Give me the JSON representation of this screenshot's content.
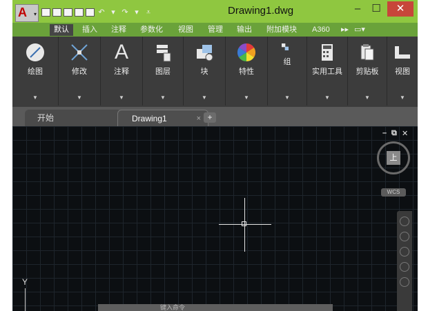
{
  "window": {
    "title": "Drawing1.dwg"
  },
  "app_menu": {
    "logo_letter": "A"
  },
  "ribbon_tabs": [
    {
      "label": "默认"
    },
    {
      "label": "插入"
    },
    {
      "label": "注释"
    },
    {
      "label": "参数化"
    },
    {
      "label": "视图"
    },
    {
      "label": "管理"
    },
    {
      "label": "输出"
    },
    {
      "label": "附加模块"
    },
    {
      "label": "A360"
    }
  ],
  "ribbon_panels": [
    {
      "label": "绘图",
      "icon": "line-draw-icon"
    },
    {
      "label": "修改",
      "icon": "move-icon"
    },
    {
      "label": "注释",
      "icon": "text-icon",
      "glyph": "A"
    },
    {
      "label": "图层",
      "icon": "layers-icon"
    },
    {
      "label": "块",
      "icon": "block-icon"
    },
    {
      "label": "特性",
      "icon": "color-wheel-icon"
    },
    {
      "label": "组",
      "icon": "group-icon"
    },
    {
      "label": "实用工具",
      "icon": "calculator-icon"
    },
    {
      "label": "剪贴板",
      "icon": "clipboard-icon"
    },
    {
      "label": "视图",
      "icon": "view-icon"
    }
  ],
  "doc_tabs": {
    "start": "开始",
    "current": "Drawing1",
    "close": "×",
    "new": "+"
  },
  "viewport": {
    "cube_face": "上",
    "wcs": "WCS",
    "y_axis": "Y"
  },
  "command_line": {
    "text": "键入命令"
  },
  "colors": {
    "titlebar": "#8fc740",
    "canvas": "#0c0f12",
    "ribbon": "#3c3c3c",
    "close": "#c7463a"
  }
}
